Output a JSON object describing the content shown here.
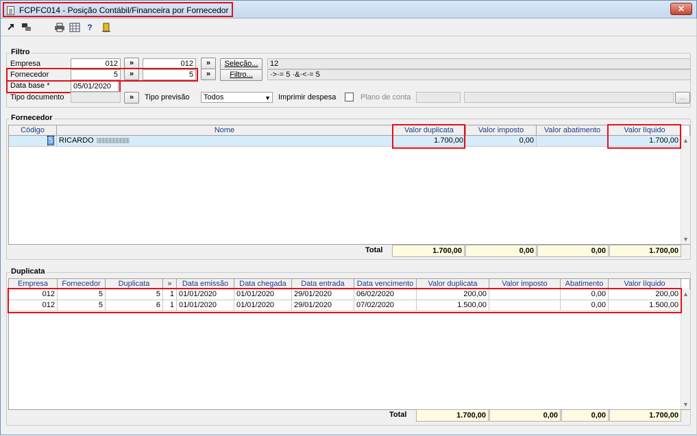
{
  "window": {
    "title": "FCPFC014 - Posição Contábil/Financeira por Fornecedor",
    "close_label": "✕"
  },
  "toolbar": {
    "icons": [
      "arrow-export-icon",
      "transfer-icon",
      "print-icon",
      "calendar-grid-icon",
      "help-icon",
      "exit-door-icon"
    ]
  },
  "filtro": {
    "legend": "Filtro",
    "empresa_label": "Empresa",
    "empresa_from": "012",
    "empresa_to": "012",
    "fornecedor_label": "Fornecedor",
    "fornecedor_from": "5",
    "fornecedor_to": "5",
    "data_base_label": "Data base *",
    "data_base_value": "05/01/2020",
    "tipo_documento_label": "Tipo documento",
    "tipo_documento_value": "",
    "tipo_previsao_label": "Tipo previsão",
    "tipo_previsao_value": "Todos",
    "imprimir_despesa_label": "Imprimir despesa",
    "plano_conta_label": "Plano de conta",
    "range_btn": "»",
    "selecao_btn": "Seleção...",
    "filtro_btn": "Filtro...",
    "selecao_value": "12",
    "filtro_value": "·>·= 5 ·&·<·= 5",
    "ellipsis_btn": "..."
  },
  "fornecedor": {
    "legend": "Fornecedor",
    "headers": [
      "Código",
      "Nome",
      "Valor duplicata",
      "Valor imposto",
      "Valor abatimento",
      "Valor líquido"
    ],
    "rows": [
      {
        "codigo": "5",
        "nome": "RICARDO",
        "valor_duplicata": "1.700,00",
        "valor_imposto": "0,00",
        "valor_abatimento": "",
        "valor_liquido": "1.700,00"
      }
    ],
    "total_label": "Total",
    "totals": [
      "1.700,00",
      "0,00",
      "0,00",
      "1.700,00"
    ]
  },
  "duplicata": {
    "legend": "Duplicata",
    "headers": [
      "Empresa",
      "Fornecedor",
      "Duplicata",
      "»",
      "Data emissão",
      "Data chegada",
      "Data entrada",
      "Data vencimento",
      "Valor duplicata",
      "Valor imposto",
      "Abatimento",
      "Valor líquido"
    ],
    "rows": [
      {
        "empresa": "012",
        "fornecedor": "5",
        "duplicata": "5",
        "parcela": "1",
        "data_emissao": "01/01/2020",
        "data_chegada": "01/01/2020",
        "data_entrada": "29/01/2020",
        "data_vencimento": "06/02/2020",
        "valor_duplicata": "200,00",
        "valor_imposto": "",
        "abatimento": "0,00",
        "valor_liquido": "200,00"
      },
      {
        "empresa": "012",
        "fornecedor": "5",
        "duplicata": "6",
        "parcela": "1",
        "data_emissao": "01/01/2020",
        "data_chegada": "01/01/2020",
        "data_entrada": "29/01/2020",
        "data_vencimento": "07/02/2020",
        "valor_duplicata": "1.500,00",
        "valor_imposto": "",
        "abatimento": "0,00",
        "valor_liquido": "1.500,00"
      }
    ],
    "total_label": "Total",
    "totals": [
      "1.700,00",
      "0,00",
      "0,00",
      "1.700,00"
    ]
  },
  "scroll": {
    "up": "▲",
    "down": "▼"
  },
  "colors": {
    "highlight": "#e0101a",
    "selected_row": "#d6ecfa",
    "total_bg": "#fffbe0",
    "header_text": "#1a3a8a"
  }
}
